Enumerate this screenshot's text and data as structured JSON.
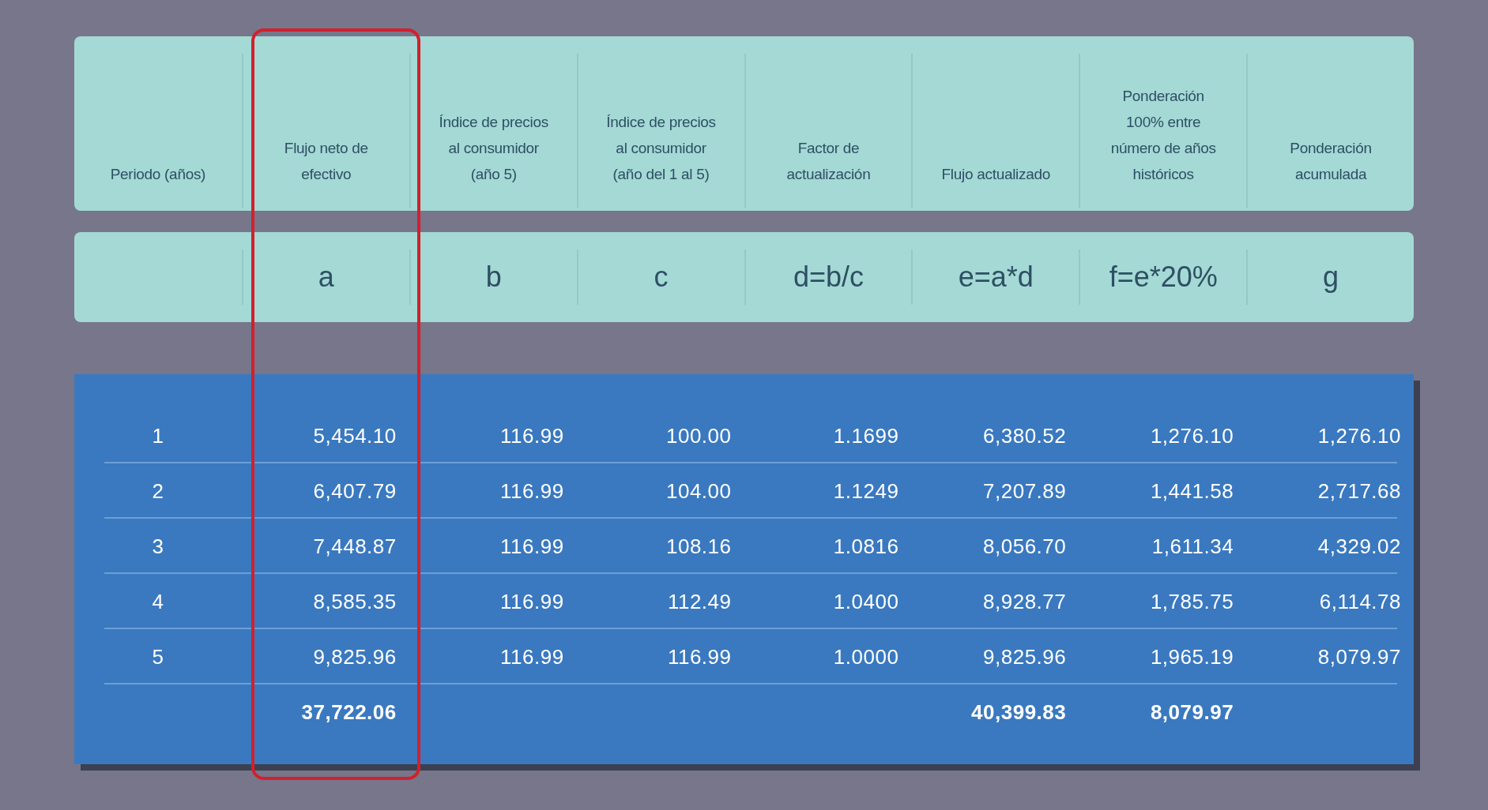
{
  "columns": [
    {
      "label": "Periodo (años)",
      "highlighted": false
    },
    {
      "label": "Flujo neto de efectivo",
      "highlighted": true
    },
    {
      "label": "Índice de precios al consumidor (año 5)",
      "highlighted": false
    },
    {
      "label": "Índice de precios al consumidor (año del 1 al 5)",
      "highlighted": false
    },
    {
      "label": "Factor de actualización",
      "highlighted": false
    },
    {
      "label": "Flujo actualizado",
      "highlighted": false
    },
    {
      "label": "Ponderación 100% entre número de años históricos",
      "highlighted": false
    },
    {
      "label": "Ponderación acumulada",
      "highlighted": false
    }
  ],
  "formulas": [
    "a",
    "b",
    "c",
    "d=b/c",
    "e=a*d",
    "f=e*20%",
    "g"
  ],
  "rows": [
    {
      "period": "1",
      "values": [
        "5,454.10",
        "116.99",
        "100.00",
        "1.1699",
        "6,380.52",
        "1,276.10",
        "1,276.10"
      ]
    },
    {
      "period": "2",
      "values": [
        "6,407.79",
        "116.99",
        "104.00",
        "1.1249",
        "7,207.89",
        "1,441.58",
        "2,717.68"
      ]
    },
    {
      "period": "3",
      "values": [
        "7,448.87",
        "116.99",
        "108.16",
        "1.0816",
        "8,056.70",
        "1,611.34",
        "4,329.02"
      ]
    },
    {
      "period": "4",
      "values": [
        "8,585.35",
        "116.99",
        "112.49",
        "1.0400",
        "8,928.77",
        "1,785.75",
        "6,114.78"
      ]
    },
    {
      "period": "5",
      "values": [
        "9,825.96",
        "116.99",
        "116.99",
        "1.0000",
        "9,825.96",
        "1,965.19",
        "8,079.97"
      ]
    }
  ],
  "totals": {
    "a": "37,722.06",
    "e": "40,399.83",
    "f": "8,079.97"
  }
}
